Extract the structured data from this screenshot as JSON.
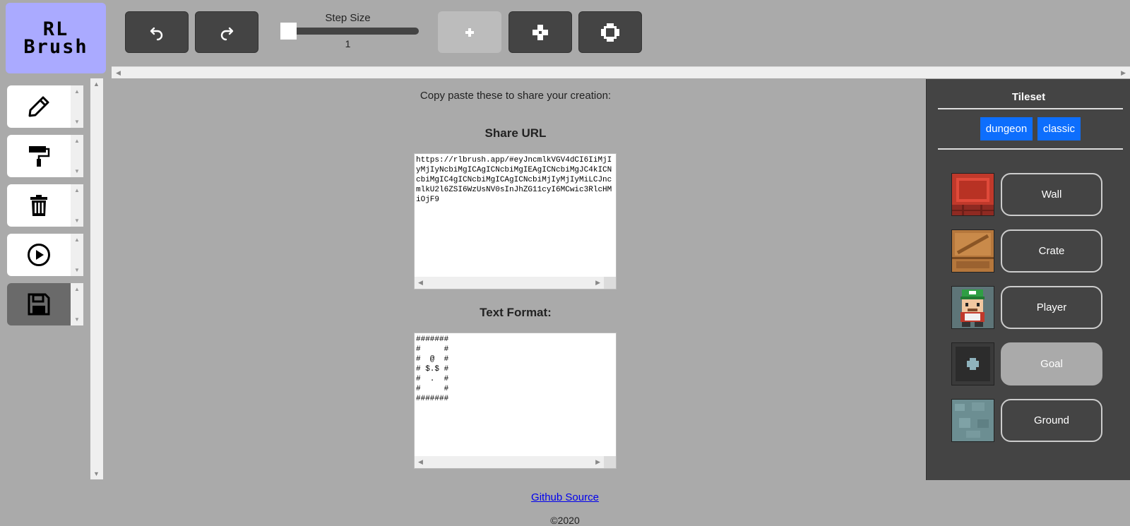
{
  "logo": {
    "line1": "RL",
    "line2": "Brush"
  },
  "toolbar": {
    "undo_icon": "undo-icon",
    "redo_icon": "redo-icon",
    "step_size_label": "Step Size",
    "step_size_value": "1",
    "brush_sizes": [
      "brush-small-icon",
      "brush-medium-icon",
      "brush-large-icon"
    ]
  },
  "tools": [
    "pencil-icon",
    "paint-roller-icon",
    "trash-icon",
    "play-icon",
    "save-icon"
  ],
  "share": {
    "intro": "Copy paste these to share your creation:",
    "url_heading": "Share URL",
    "url_value": "https://rlbrush.app/#eyJncmlkVGV4dCI6IiMjIyMjIyNcbiMgICAgICNcbiMgIEAgICNcbiMgJC4kICNcbiMgIC4gICNcbiMgICAgICNcbiMjIyMjIyMiLCJncmlkU2l6ZSI6WzUsNV0sInJhZG11cyI6MCwic3RlcHMiOjF9",
    "text_heading": "Text Format:",
    "text_value": "#######\n#     #\n#  @  #\n# $.$ #\n#  .  #\n#     #\n#######"
  },
  "footer": {
    "github": "Github Source",
    "copyright": "©2020"
  },
  "tileset": {
    "title": "Tileset",
    "options": [
      "dungeon",
      "classic"
    ],
    "tiles": [
      {
        "label": "Wall",
        "icon": "wall-tile-icon"
      },
      {
        "label": "Crate",
        "icon": "crate-tile-icon"
      },
      {
        "label": "Player",
        "icon": "player-tile-icon"
      },
      {
        "label": "Goal",
        "icon": "goal-tile-icon",
        "selected": true
      },
      {
        "label": "Ground",
        "icon": "ground-tile-icon"
      }
    ]
  },
  "colors": {
    "logo_bg": "#aaaaff",
    "button_dark": "#444444",
    "tileset_button": "#0d6efd"
  }
}
